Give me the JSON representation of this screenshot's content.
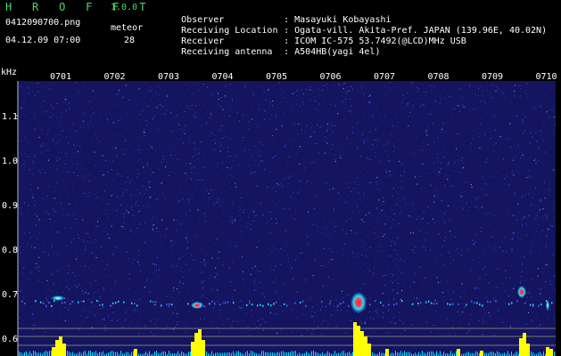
{
  "header": {
    "app_name": "H R O F F T",
    "app_version": "1.0.0",
    "filename": "0412090700.png",
    "datetime": "04.12.09 07:00",
    "meteor_label": "meteor",
    "meteor_count": "28"
  },
  "info": [
    {
      "label": "Observer",
      "value": ": Masayuki Kobayashi"
    },
    {
      "label": "Receiving Location",
      "value": ": Ogata-vill. Akita-Pref. JAPAN (139.96E, 40.02N)"
    },
    {
      "label": "Receiver",
      "value": ": ICOM IC-575 53.7492(@LCD)MHz USB"
    },
    {
      "label": "Receiving antenna",
      "value": ": A504HB(yagi 4el)"
    }
  ],
  "spectrogram": {
    "y_unit": "kHz",
    "y_ticks": [
      "1.1",
      "1.0",
      "0.9",
      "0.8",
      "0.7",
      "0.6"
    ],
    "x_ticks": [
      "0701",
      "0702",
      "0703",
      "0704",
      "0705",
      "0706",
      "0707",
      "0708",
      "0709",
      "0710"
    ],
    "colors": {
      "background": "#14145f",
      "noise": "#4b5cff",
      "echo_hot": "#ff2b2b",
      "echo_cool": "#22e0ff",
      "histogram": "#ffff00",
      "baseline": "#00e5ff"
    }
  }
}
